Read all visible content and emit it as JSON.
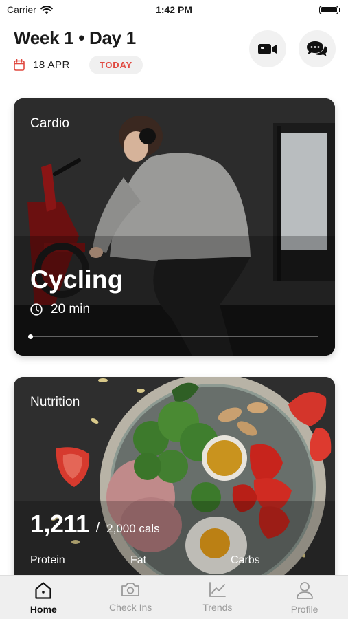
{
  "status_bar": {
    "carrier": "Carrier",
    "time": "1:42 PM"
  },
  "header": {
    "title": "Week 1 • Day 1",
    "date": "18 APR",
    "today_label": "TODAY",
    "icons": [
      "calendar-icon",
      "video-camera-icon",
      "chat-bubbles-icon"
    ]
  },
  "cardio": {
    "label": "Cardio",
    "title": "Cycling",
    "duration": "20 min",
    "progress": 0
  },
  "nutrition": {
    "label": "Nutrition",
    "calories": "1,211",
    "separator": "/",
    "goal": "2,000 cals",
    "macros": [
      "Protein",
      "Fat",
      "Carbs"
    ]
  },
  "tabs": [
    {
      "label": "Home",
      "icon": "home-icon",
      "active": true
    },
    {
      "label": "Check Ins",
      "icon": "camera-icon",
      "active": false
    },
    {
      "label": "Trends",
      "icon": "chart-icon",
      "active": false
    },
    {
      "label": "Profile",
      "icon": "person-icon",
      "active": false
    }
  ],
  "colors": {
    "accent": "#e0483f",
    "tab_active": "#111111",
    "tab_inactive": "#9a9a9a"
  }
}
